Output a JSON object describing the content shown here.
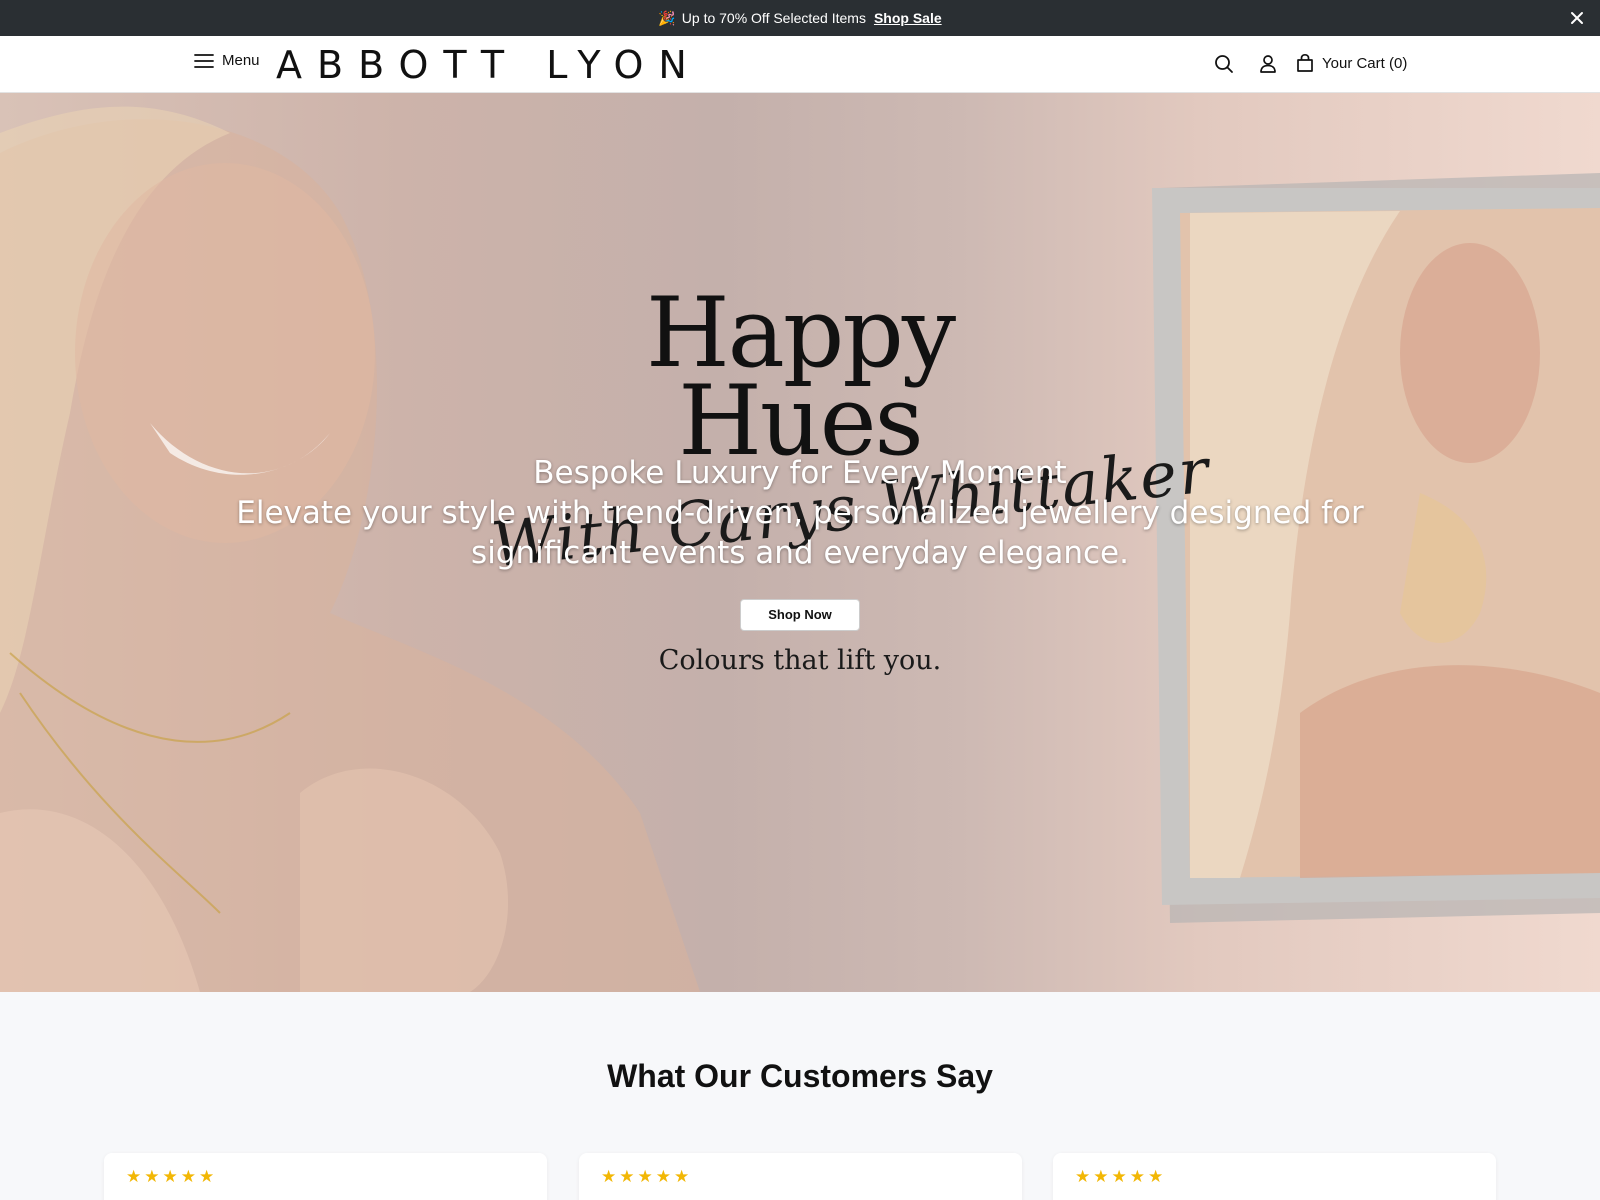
{
  "announcement": {
    "emoji": "🎉",
    "text": "Up to 70% Off Selected Items",
    "link": "Shop Sale"
  },
  "header": {
    "menu_label": "Menu",
    "logo": "ABBOTT LYON",
    "cart_label": "Your Cart (0)"
  },
  "hero": {
    "title_line1": "Happy",
    "title_line2": "Hues",
    "script": "With Carys Whittaker",
    "subtitle": "Bespoke Luxury for Every Moment",
    "description": "Elevate your style with trend-driven, personalized jewellery designed for significant events and everyday elegance.",
    "cta": "Shop Now",
    "tagline": "Colours that lift you."
  },
  "testimonials": {
    "title": "What Our Customers Say",
    "cards": [
      {
        "stars": "★★★★★",
        "rating": 5
      },
      {
        "stars": "★★★★★",
        "rating": 5
      },
      {
        "stars": "★★★★★",
        "rating": 5
      }
    ]
  },
  "colors": {
    "announcement_bg": "#2a2f33",
    "star": "#f2b705",
    "page_bg": "#f7f8fa"
  },
  "icons": [
    "party-popper-icon",
    "close-icon",
    "hamburger-menu-icon",
    "search-icon",
    "account-icon",
    "shopping-bag-icon",
    "star-icon"
  ]
}
